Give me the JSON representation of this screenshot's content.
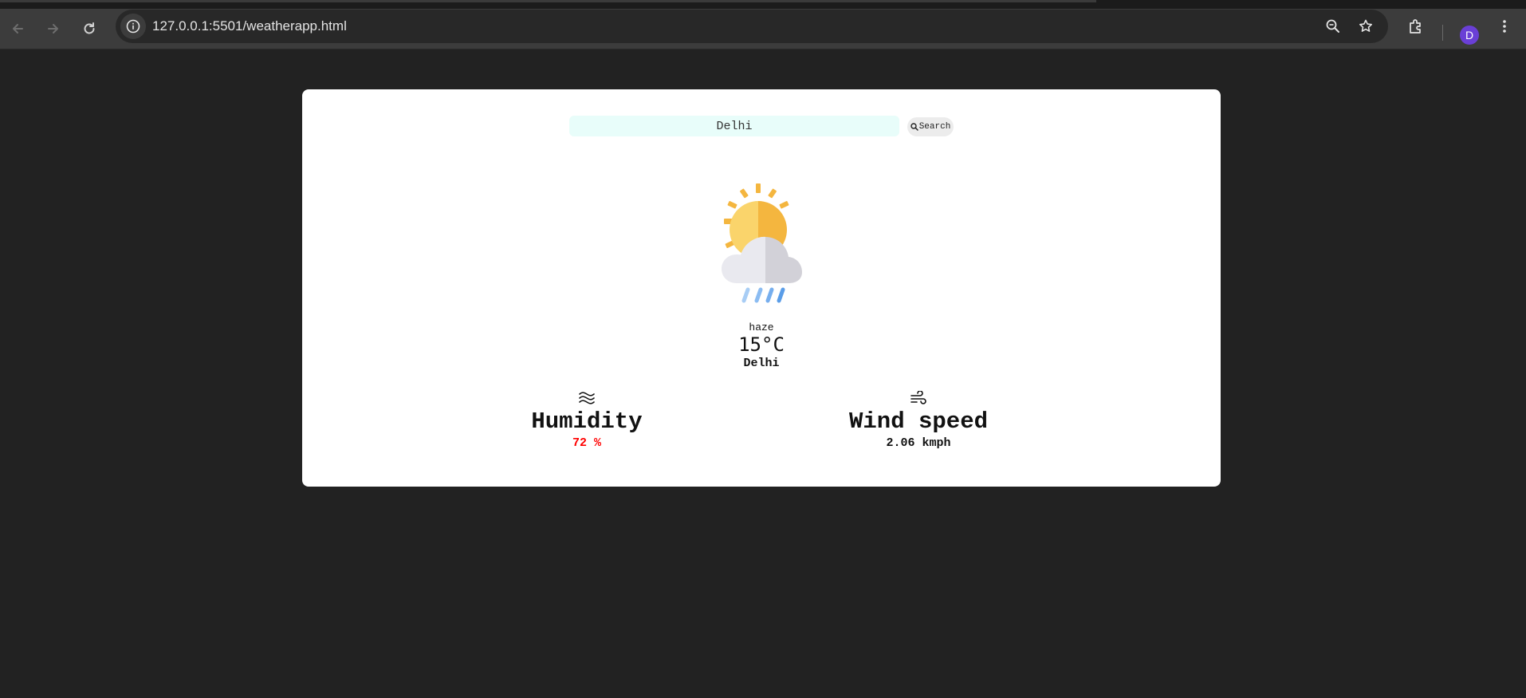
{
  "browser": {
    "url": "127.0.0.1:5501/weatherapp.html",
    "profile_initial": "D"
  },
  "search": {
    "value": "Delhi",
    "button_label": "Search"
  },
  "weather": {
    "icon": "sun-cloud-rain-icon",
    "description": "haze",
    "temperature": "15°C",
    "city": "Delhi"
  },
  "stats": {
    "humidity": {
      "icon": "waves-icon",
      "label": "Humidity",
      "value": "72 %",
      "value_color": "#ff0000"
    },
    "wind": {
      "icon": "wind-icon",
      "label": "Wind speed",
      "value": "2.06 kmph",
      "value_color": "#111111"
    }
  },
  "colors": {
    "page_background": "#222222",
    "card_background": "#ffffff",
    "input_background": "#e8fdfa",
    "browser_toolbar": "#3c3c3c",
    "avatar": "#6a3fd6"
  }
}
